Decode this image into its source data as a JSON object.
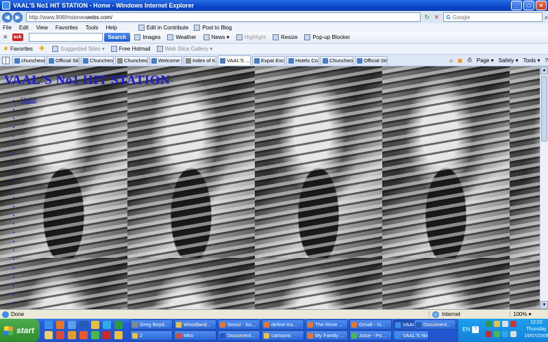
{
  "window": {
    "title": "VAAL'S No1 HIT STATION - Home - Windows Internet Explorer"
  },
  "address": {
    "url_prefix": "http://www.",
    "url_host": "906fmstereo",
    "url_rest": "webs.com/",
    "search_placeholder": "Google"
  },
  "menu": {
    "items": [
      "File",
      "Edit",
      "View",
      "Favorites",
      "Tools",
      "Help"
    ],
    "edit_contribute": "Edit in Contribute",
    "post_blog": "Post to Blog"
  },
  "toolbar": {
    "search_label": "Search",
    "images": "Images",
    "weather": "Weather",
    "news": "News ▾",
    "highlight": "Highlight",
    "resize": "Resize",
    "popup": "Pop-up Blocker"
  },
  "favorites": {
    "label": "Favorites",
    "suggested": "Suggested Sites ▾",
    "hotmail": "Free Hotmail",
    "webslice": "Web Slice Gallery ▾"
  },
  "tabs": [
    {
      "label": "chuncheon..."
    },
    {
      "label": "Official Sit..."
    },
    {
      "label": "Chuncheo..."
    },
    {
      "label": "Chuncheo..."
    },
    {
      "label": "Welcome t..."
    },
    {
      "label": "Index of K..."
    },
    {
      "label": "VAAL'S ..."
    },
    {
      "label": "Expat Exc..."
    },
    {
      "label": "Hotels Co..."
    },
    {
      "label": "Chuncheo..."
    },
    {
      "label": "Official Sit..."
    }
  ],
  "tab_tools": {
    "page": "Page ▾",
    "safety": "Safety ▾",
    "tools": "Tools ▾",
    "help": "?"
  },
  "page": {
    "site_title": "VAAL'S No1 HIT STATION",
    "nav_links": [
      "Home",
      "",
      "",
      "",
      "",
      "",
      "",
      "",
      "",
      "",
      "",
      "",
      "",
      "",
      "",
      "",
      "",
      "",
      "",
      "",
      "",
      "",
      "",
      "",
      "",
      "",
      "",
      ""
    ]
  },
  "status": {
    "text": "Done",
    "zone": "Internet",
    "zoom": "100% ▾"
  },
  "taskbar": {
    "start": "start",
    "buttons": [
      "Greg Boyd...",
      "Woodland...",
      "Seoul - So...",
      "define:tra...",
      "The Rime ...",
      "Gmail - In...",
      "VAAL'S No...",
      "2",
      "Miro",
      "Document...",
      "cartoons",
      "My Family ...",
      "Juice - Po...",
      "VAAL'S No..."
    ],
    "extra_button": "Document...",
    "lang": "EN",
    "help": "?",
    "clock": {
      "time": "12:22",
      "day": "Thursday",
      "date": "16/07/2009"
    }
  },
  "colors": {
    "link": "#1a1adb",
    "titlebar": "#0a46c8",
    "taskbar": "#245ddb",
    "start": "#2e8a2e"
  }
}
